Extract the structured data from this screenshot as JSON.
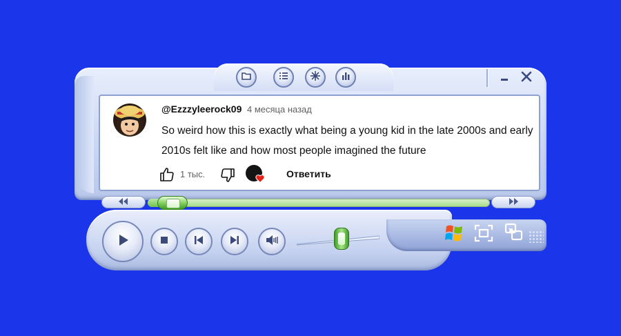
{
  "colors": {
    "background": "#1a35ea",
    "accent_green": "#6fc34c",
    "heart": "#e62117"
  },
  "toolbar": {
    "icons": [
      "folder-icon",
      "list-icon",
      "visualization-icon",
      "equalizer-icon"
    ],
    "window_controls": [
      "minimize-icon",
      "close-icon"
    ]
  },
  "comment": {
    "username": "@Ezzzyleerock09",
    "time_ago": "4 месяца назад",
    "text": "So weird how this is exactly what being a young kid in the late 2000s and early 2010s felt like and how most people imagined the future",
    "likes": "1 тыс.",
    "reply_label": "Ответить",
    "creator_heart": true
  },
  "seek": {
    "progress_fraction": 0.03,
    "rewind_icon": "rewind-icon",
    "forward_icon": "fast-forward-icon"
  },
  "controls": {
    "buttons": [
      "play-icon",
      "stop-icon",
      "previous-icon",
      "next-icon",
      "volume-icon"
    ],
    "volume_fraction": 0.55
  },
  "right_panel": {
    "icons": [
      "windows-logo-icon",
      "mini-mode-icon",
      "switch-to-library-icon"
    ]
  }
}
